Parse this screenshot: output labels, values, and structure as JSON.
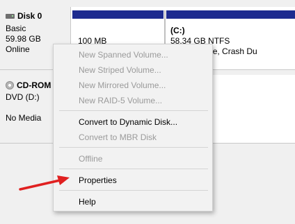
{
  "disk0": {
    "name": "Disk 0",
    "type": "Basic",
    "size": "59.98 GB",
    "status": "Online",
    "partitions": [
      {
        "size": "100 MB"
      },
      {
        "name": "(C:)",
        "size": "58.34 GB NTFS",
        "status_visible": "ot, Page File, Crash Du"
      }
    ]
  },
  "cdrom": {
    "name": "CD-ROM",
    "drive": "DVD (D:)",
    "media": "No Media"
  },
  "context_menu": {
    "items": [
      {
        "label": "New Spanned Volume...",
        "enabled": false
      },
      {
        "label": "New Striped Volume...",
        "enabled": false
      },
      {
        "label": "New Mirrored Volume...",
        "enabled": false
      },
      {
        "label": "New RAID-5 Volume...",
        "enabled": false
      },
      {
        "label": "Convert to Dynamic Disk...",
        "enabled": true
      },
      {
        "label": "Convert to MBR Disk",
        "enabled": false
      },
      {
        "label": "Offline",
        "enabled": false
      },
      {
        "label": "Properties",
        "enabled": true
      },
      {
        "label": "Help",
        "enabled": true
      }
    ]
  },
  "colors": {
    "partition_bar": "#1d2b8f",
    "arrow": "#e02020",
    "disabled_text": "#9a9a9a"
  }
}
